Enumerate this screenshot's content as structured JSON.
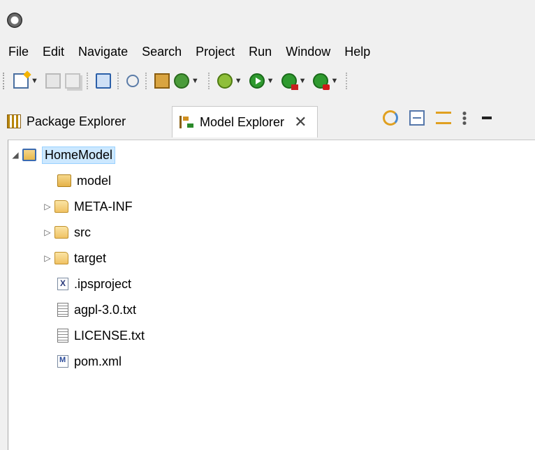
{
  "menubar": {
    "items": [
      "File",
      "Edit",
      "Navigate",
      "Search",
      "Project",
      "Run",
      "Window",
      "Help"
    ]
  },
  "toolbar": {
    "icons": [
      "new-wizard-icon",
      "save-icon",
      "save-all-icon",
      "open-terminal-icon",
      "link-icon",
      "package-icon",
      "refresh-icon",
      "debug-icon",
      "run-icon",
      "external-tools-icon",
      "external-tools-2-icon"
    ]
  },
  "tabs": [
    {
      "label": "Package Explorer",
      "icon": "package-explorer-icon",
      "active": false
    },
    {
      "label": "Model Explorer",
      "icon": "model-explorer-icon",
      "active": true,
      "close": "✕"
    }
  ],
  "view_actions": [
    "sync-icon",
    "collapse-all-icon",
    "link-with-editor-icon",
    "view-menu-icon",
    "minimize-icon"
  ],
  "tree": [
    {
      "label": "HomeModel",
      "icon": "ips-project-icon",
      "expanded": true,
      "selected": true
    },
    {
      "label": "model",
      "icon": "model-folder-icon"
    },
    {
      "label": "META-INF",
      "icon": "folder-icon",
      "collapsed": true
    },
    {
      "label": "src",
      "icon": "folder-icon",
      "collapsed": true
    },
    {
      "label": "target",
      "icon": "folder-icon",
      "collapsed": true
    },
    {
      "label": ".ipsproject",
      "icon": "xml-file-icon"
    },
    {
      "label": "agpl-3.0.txt",
      "icon": "text-file-icon"
    },
    {
      "label": "LICENSE.txt",
      "icon": "text-file-icon"
    },
    {
      "label": "pom.xml",
      "icon": "maven-file-icon"
    }
  ],
  "glyphs": {
    "expanded": "◢",
    "collapsed": "▷",
    "dropdown": "▼"
  }
}
